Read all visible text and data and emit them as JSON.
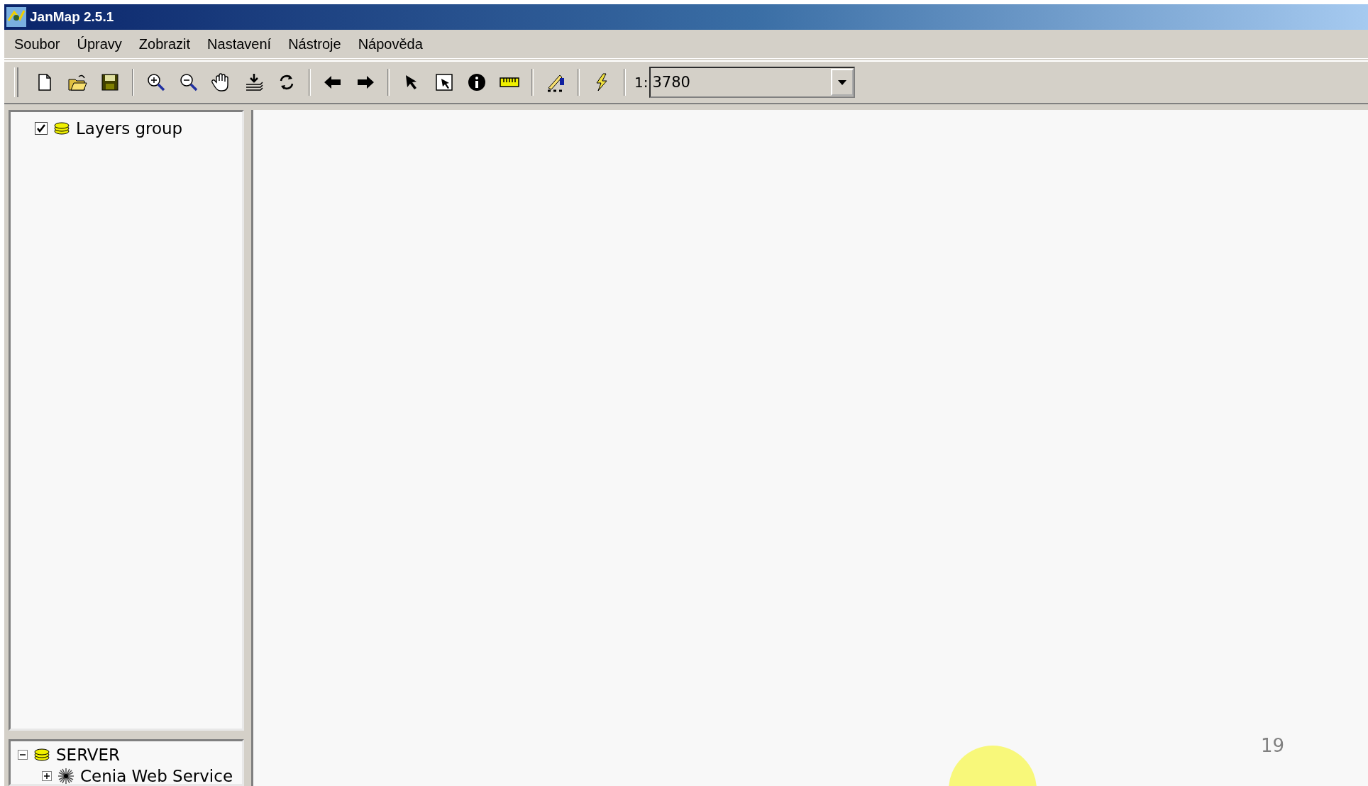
{
  "window": {
    "title": "JanMap 2.5.1"
  },
  "menu": [
    "Soubor",
    "Úpravy",
    "Zobrazit",
    "Nastavení",
    "Nástroje",
    "Nápověda"
  ],
  "toolbar": {
    "scale_prefix": "1:",
    "scale_value": "3780"
  },
  "layers_tree": [
    {
      "label": "Layers group",
      "checked": true
    }
  ],
  "server_tree": [
    {
      "label": "SERVER",
      "kind": "folder",
      "expanded": true,
      "children": [
        {
          "label": "Cenia Web Service",
          "kind": "service",
          "expanded": false
        }
      ]
    }
  ],
  "slide": {
    "page_number": "19"
  }
}
